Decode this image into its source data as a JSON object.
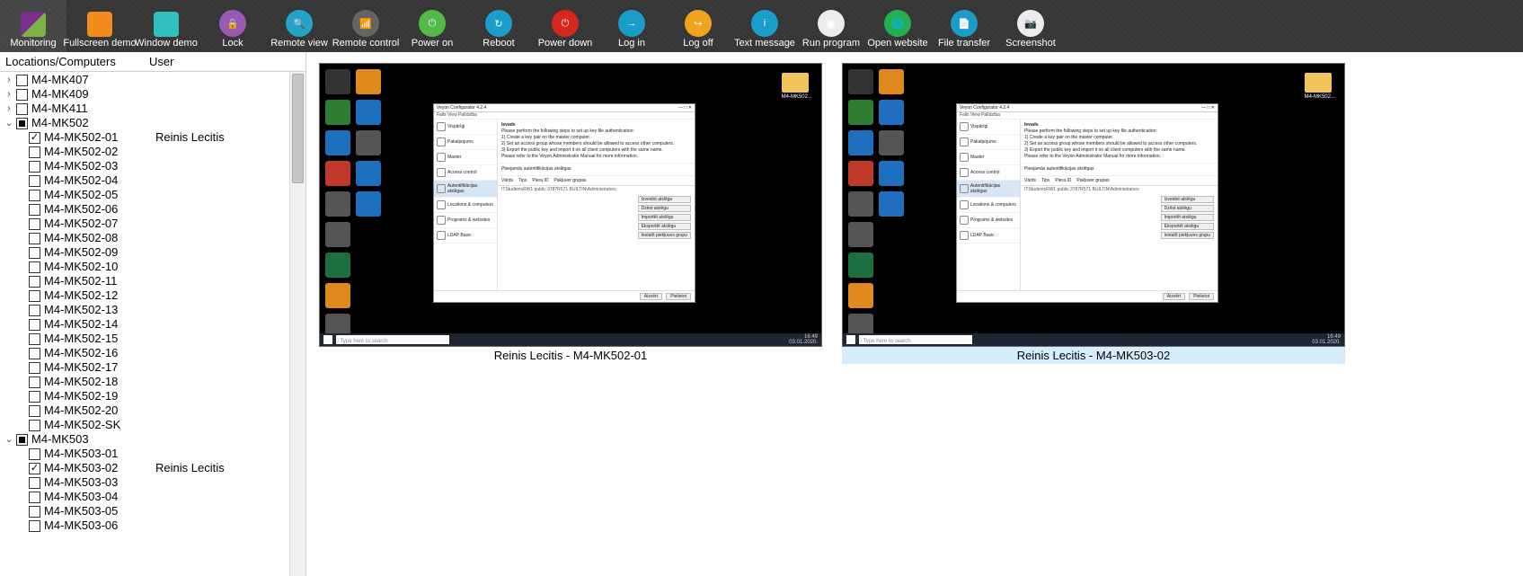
{
  "toolbar": [
    {
      "key": "monitoring",
      "label": "Monitoring"
    },
    {
      "key": "fullscreen-demo",
      "label": "Fullscreen demo"
    },
    {
      "key": "window-demo",
      "label": "Window demo"
    },
    {
      "key": "lock",
      "label": "Lock"
    },
    {
      "key": "remote-view",
      "label": "Remote view"
    },
    {
      "key": "remote-control",
      "label": "Remote control"
    },
    {
      "key": "power-on",
      "label": "Power on"
    },
    {
      "key": "reboot",
      "label": "Reboot"
    },
    {
      "key": "power-down",
      "label": "Power down"
    },
    {
      "key": "log-in",
      "label": "Log in"
    },
    {
      "key": "log-off",
      "label": "Log off"
    },
    {
      "key": "text-message",
      "label": "Text message"
    },
    {
      "key": "run-program",
      "label": "Run program"
    },
    {
      "key": "open-website",
      "label": "Open website"
    },
    {
      "key": "file-transfer",
      "label": "File transfer"
    },
    {
      "key": "screenshot",
      "label": "Screenshot"
    }
  ],
  "tree_header": {
    "col1": "Locations/Computers",
    "col2": "User"
  },
  "tree": [
    {
      "lvl": 1,
      "toggle": ">",
      "name": "M4-MK407"
    },
    {
      "lvl": 1,
      "toggle": ">",
      "name": "M4-MK409"
    },
    {
      "lvl": 1,
      "toggle": ">",
      "name": "M4-MK411"
    },
    {
      "lvl": 1,
      "toggle": "v",
      "name": "M4-MK502",
      "state": "mixed"
    },
    {
      "lvl": 2,
      "name": "M4-MK502-01",
      "state": "checked",
      "user": "Reinis Lecitis"
    },
    {
      "lvl": 2,
      "name": "M4-MK502-02"
    },
    {
      "lvl": 2,
      "name": "M4-MK502-03"
    },
    {
      "lvl": 2,
      "name": "M4-MK502-04"
    },
    {
      "lvl": 2,
      "name": "M4-MK502-05"
    },
    {
      "lvl": 2,
      "name": "M4-MK502-06"
    },
    {
      "lvl": 2,
      "name": "M4-MK502-07"
    },
    {
      "lvl": 2,
      "name": "M4-MK502-08"
    },
    {
      "lvl": 2,
      "name": "M4-MK502-09"
    },
    {
      "lvl": 2,
      "name": "M4-MK502-10"
    },
    {
      "lvl": 2,
      "name": "M4-MK502-11"
    },
    {
      "lvl": 2,
      "name": "M4-MK502-12"
    },
    {
      "lvl": 2,
      "name": "M4-MK502-13"
    },
    {
      "lvl": 2,
      "name": "M4-MK502-14"
    },
    {
      "lvl": 2,
      "name": "M4-MK502-15"
    },
    {
      "lvl": 2,
      "name": "M4-MK502-16"
    },
    {
      "lvl": 2,
      "name": "M4-MK502-17"
    },
    {
      "lvl": 2,
      "name": "M4-MK502-18"
    },
    {
      "lvl": 2,
      "name": "M4-MK502-19"
    },
    {
      "lvl": 2,
      "name": "M4-MK502-20"
    },
    {
      "lvl": 2,
      "name": "M4-MK502-SK"
    },
    {
      "lvl": 1,
      "toggle": "v",
      "name": "M4-MK503",
      "state": "mixed"
    },
    {
      "lvl": 2,
      "name": "M4-MK503-01"
    },
    {
      "lvl": 2,
      "name": "M4-MK503-02",
      "state": "checked",
      "user": "Reinis Lecitis"
    },
    {
      "lvl": 2,
      "name": "M4-MK503-03"
    },
    {
      "lvl": 2,
      "name": "M4-MK503-04"
    },
    {
      "lvl": 2,
      "name": "M4-MK503-05"
    },
    {
      "lvl": 2,
      "name": "M4-MK503-06"
    }
  ],
  "tiles": [
    {
      "caption": "Reinis Lecitis - M4-MK502-01",
      "selected": false
    },
    {
      "caption": "Reinis Lecitis - M4-MK503-02",
      "selected": true
    }
  ],
  "remote": {
    "folder_label": "M4-MK502...",
    "search_placeholder": "Type here to search",
    "clock": "16:49",
    "date": "03.01.2020.",
    "win": {
      "title": "Veyon Configurator 4.2.4",
      "ctrls": "—  □  ✕",
      "menu": "Fails   View   Palīdzība",
      "side": [
        "Vispārīgi",
        "Pakalpojums",
        "Master",
        "Access control",
        "Autentifikācijas atslēgas",
        "Locations & computers",
        "Programs & websites",
        "LDAP Basic"
      ],
      "side_selected": 4,
      "inst_title": "Ievads",
      "inst_lines": [
        "Please perform the following steps to set up key file authentication:",
        "1) Create a key pair on the master computer.",
        "2) Set an access group whose members should be allowed to access other computers.",
        "3) Export the public key and import it on all client computers with the same name.",
        "Please refer to the Veyon Administrator Manual for more information."
      ],
      "section": "Pieejamās autentifikācijas atslēgas",
      "columns": [
        "Vārds",
        "Tips",
        "Piera ID",
        "Pakļuver grupas"
      ],
      "row": "ITStudentsRW1   public   3787R571   BUILTIN\\Administrators",
      "buttons": [
        "Izveidot atslēgu",
        "Dzēst atslēgu",
        "Importēt atslēgu",
        "Eksportēt atslēgu",
        "Iestatīt piekļuves grupu"
      ],
      "footer": [
        "Aizvērt",
        "Pielietot"
      ]
    }
  }
}
